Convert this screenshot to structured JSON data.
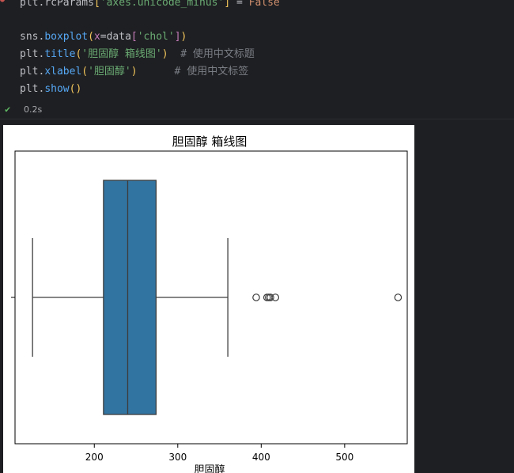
{
  "code": {
    "line0": {
      "obj": "plt",
      "dot": ".",
      "attr": "rcParams",
      "b1": "[",
      "key": "'axes.unicode_minus'",
      "b2": "]",
      "eq": " = ",
      "val": "False"
    },
    "line1": {
      "obj": "sns",
      "dot": ".",
      "fn": "boxplot",
      "p1": "(",
      "kw": "x",
      "eq": "=",
      "arg": "data",
      "b1": "[",
      "str": "'chol'",
      "b2": "]",
      "p2": ")"
    },
    "line2": {
      "obj": "plt",
      "dot": ".",
      "fn": "title",
      "p1": "(",
      "str": "'胆固醇 箱线图'",
      "p2": ")",
      "comment": "  # 使用中文标题"
    },
    "line3": {
      "obj": "plt",
      "dot": ".",
      "fn": "xlabel",
      "p1": "(",
      "str": "'胆固醇'",
      "p2": ")",
      "comment": "      # 使用中文标签"
    },
    "line4": {
      "obj": "plt",
      "dot": ".",
      "fn": "show",
      "p1": "(",
      "p2": ")"
    }
  },
  "status": {
    "check": "✔",
    "time": "0.2s"
  },
  "chart_data": {
    "type": "box",
    "title": "胆固醇 箱线图",
    "xlabel": "胆固醇",
    "ylabel": "",
    "xlim": [
      105,
      575
    ],
    "xticks": [
      200,
      300,
      400,
      500
    ],
    "xtick_labels": [
      "200",
      "300",
      "400",
      "500"
    ],
    "box": {
      "whisker_low": 126,
      "q1": 211,
      "median": 240,
      "q3": 274,
      "whisker_high": 360
    },
    "outliers": [
      394,
      407,
      409,
      411,
      417,
      564
    ],
    "color": "#3274a1",
    "grid": false
  }
}
